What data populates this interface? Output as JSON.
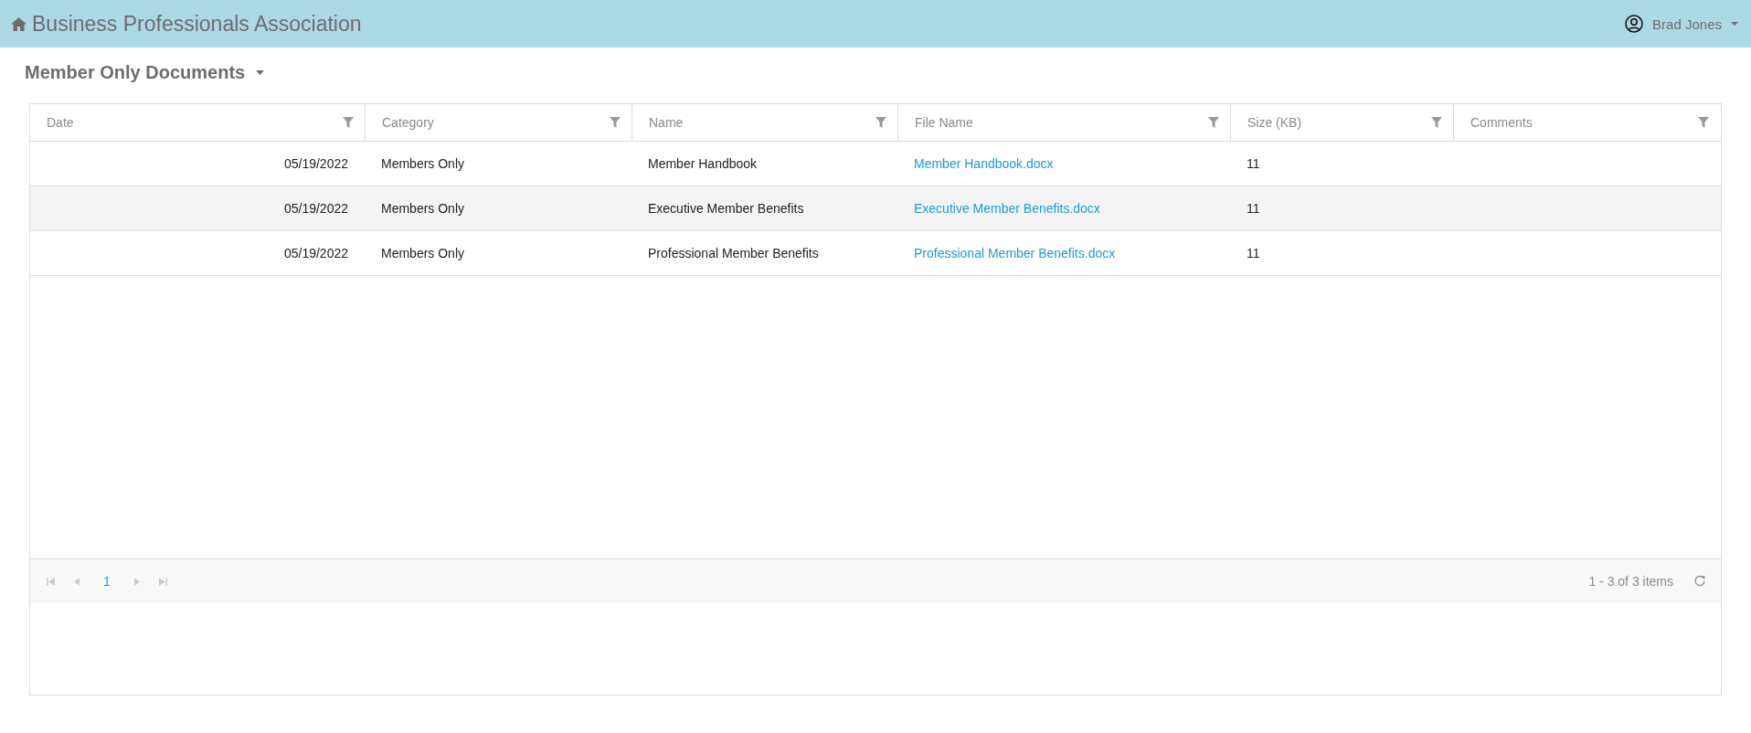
{
  "header": {
    "title": "Business Professionals Association",
    "user": "Brad Jones"
  },
  "page": {
    "title": "Member Only Documents"
  },
  "table": {
    "columns": [
      "Date",
      "Category",
      "Name",
      "File Name",
      "Size (KB)",
      "Comments"
    ],
    "rows": [
      {
        "date": "05/19/2022",
        "category": "Members Only",
        "name": "Member Handbook",
        "file_name": "Member Handbook.docx",
        "size": "11"
      },
      {
        "date": "05/19/2022",
        "category": "Members Only",
        "name": "Executive Member Benefits",
        "file_name": "Executive Member Benefits.docx",
        "size": "11"
      },
      {
        "date": "05/19/2022",
        "category": "Members Only",
        "name": "Professional Member Benefits",
        "file_name": "Professional Member Benefits.docx",
        "size": "11"
      }
    ]
  },
  "pager": {
    "pages": [
      {
        "label": "1",
        "selected": true
      }
    ],
    "info": "1 - 3 of 3 items"
  }
}
